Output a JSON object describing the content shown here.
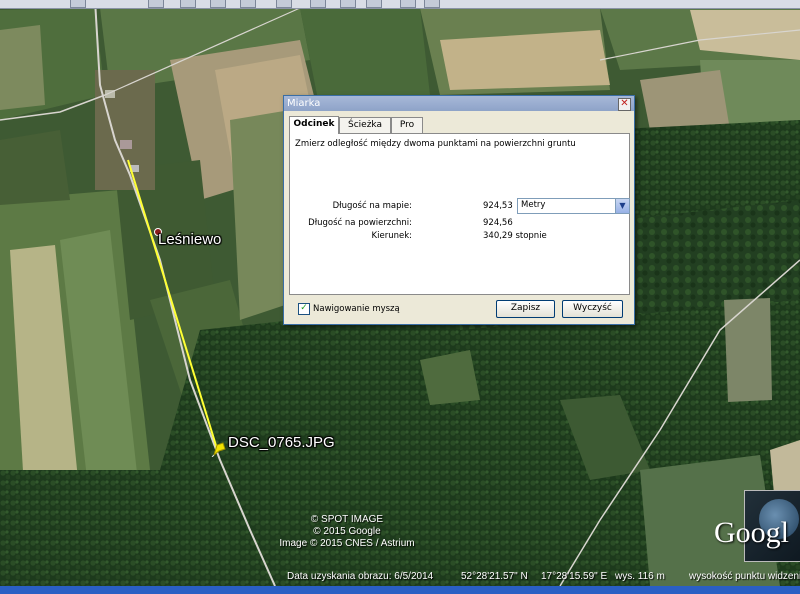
{
  "map": {
    "placemarks": [
      {
        "label": "Leśniewo",
        "icon": "placemark-dot-icon"
      },
      {
        "label": "DSC_0765.JPG",
        "icon": "pushpin-icon"
      }
    ],
    "credits": [
      "© SPOT IMAGE",
      "© 2015 Google",
      "Image © 2015 CNES / Astrium"
    ],
    "logo": "Googl",
    "measure_line_color": "#ffff33"
  },
  "statusbar": {
    "imagery_date": "Data uzyskania obrazu: 6/5/2014",
    "latitude": "52°28'21.57\" N",
    "longitude": "17°28'15.59\" E",
    "elevation": "wys.  116 m",
    "eye_alt": "wysokość punktu widzenia"
  },
  "dialog": {
    "title": "Miarka",
    "close_glyph": "✕",
    "tabs": [
      "Odcinek",
      "Ścieżka",
      "Pro"
    ],
    "active_tab": "Odcinek",
    "description": "Zmierz odległość między dwoma punktami na powierzchni gruntu",
    "map_length_label": "Długość na mapie:",
    "map_length_value": "924,53",
    "unit_selected": "Metry",
    "ground_length_label": "Długość na powierzchni:",
    "ground_length_value": "924,56",
    "heading_label": "Kierunek:",
    "heading_value": "340,29 stopnie",
    "mouse_nav_label": "Nawigowanie myszą",
    "mouse_nav_checked": true,
    "save_label": "Zapisz",
    "clear_label": "Wyczyść"
  }
}
